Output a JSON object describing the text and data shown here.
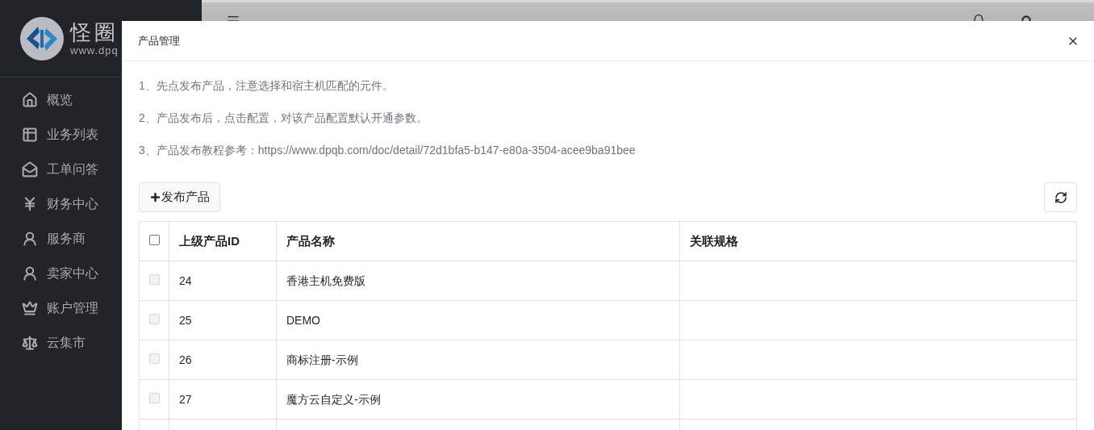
{
  "sidebar": {
    "logo": {
      "title": "怪圈",
      "subtitle": "www.dpq"
    },
    "items": [
      {
        "label": "概览"
      },
      {
        "label": "业务列表"
      },
      {
        "label": "工单问答"
      },
      {
        "label": "财务中心"
      },
      {
        "label": "服务商"
      },
      {
        "label": "卖家中心"
      },
      {
        "label": "账户管理"
      },
      {
        "label": "云集市"
      }
    ]
  },
  "modal": {
    "title": "产品管理",
    "notes": [
      "1、先点发布产品，注意选择和宿主机匹配的元件。",
      "2、产品发布后，点击配置，对该产品配置默认开通参数。",
      "3、产品发布教程参考：https://www.dpqb.com/doc/detail/72d1bfa5-b147-e80a-3504-acee9ba91bee"
    ],
    "publish_button": "发布产品",
    "table": {
      "select_all": {
        "checked": false,
        "disabled": false
      },
      "columns": [
        "上级产品ID",
        "产品名称",
        "关联规格"
      ],
      "rows": [
        {
          "checked": false,
          "disabled": true,
          "cells": [
            "24",
            "香港主机免费版",
            ""
          ]
        },
        {
          "checked": false,
          "disabled": true,
          "cells": [
            "25",
            "DEMO",
            ""
          ]
        },
        {
          "checked": false,
          "disabled": true,
          "cells": [
            "26",
            "商标注册-示例",
            ""
          ]
        },
        {
          "checked": false,
          "disabled": true,
          "cells": [
            "27",
            "魔方云自定义-示例",
            ""
          ]
        }
      ]
    }
  }
}
